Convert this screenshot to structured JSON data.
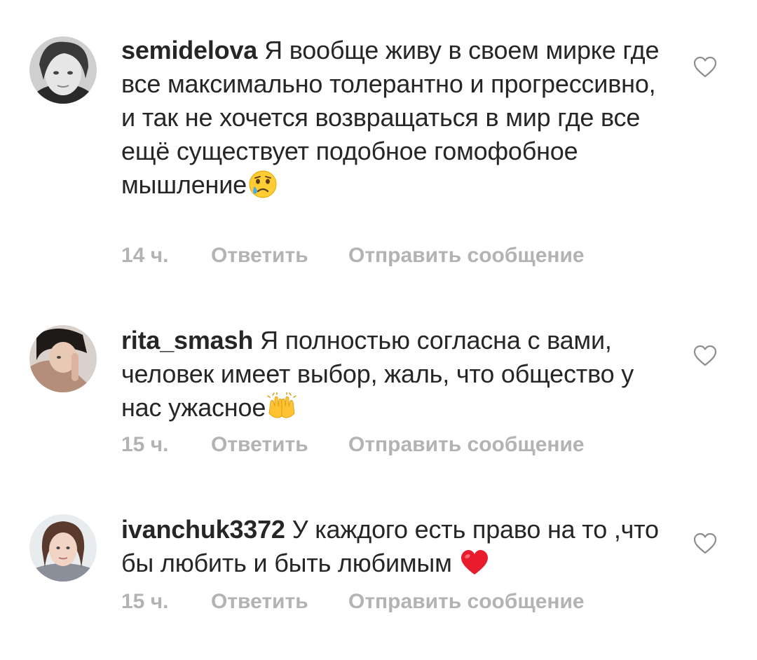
{
  "comments": [
    {
      "username": "semidelova",
      "text": "Я вообще живу в своем мирке где все максимально толерантно и прогрессивно, и так не хочется возвращаться в мир где все ещё существует подобное гомофобное мышление",
      "emoji": "crying-face-emoji",
      "time": "14 ч.",
      "reply_label": "Ответить",
      "send_label": "Отправить сообщение"
    },
    {
      "username": "rita_smash",
      "text": "Я полностью согласна с вами, человек имеет выбор, жаль, что общество у нас ужасное",
      "emoji": "raising-hands-emoji",
      "time": "15 ч.",
      "reply_label": "Ответить",
      "send_label": "Отправить сообщение"
    },
    {
      "username": "ivanchuk3372",
      "text": "У каждого есть право на то ,что бы любить и быть любимым",
      "emoji": "red-heart-emoji",
      "time": "15 ч.",
      "reply_label": "Ответить",
      "send_label": "Отправить сообщение"
    }
  ],
  "colors": {
    "text": "#262626",
    "meta": "#b3b3b3",
    "heart": "#e0245e"
  }
}
